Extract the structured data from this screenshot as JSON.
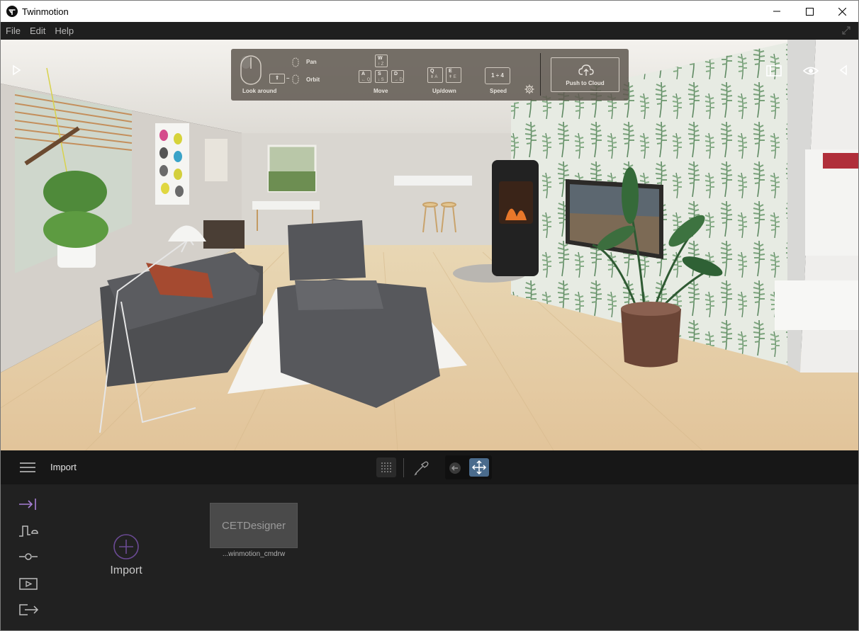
{
  "window": {
    "title": "Twinmotion",
    "logo_icon": "twinmotion-logo",
    "controls": [
      "minimize-icon",
      "maximize-icon",
      "close-icon"
    ]
  },
  "menu": {
    "items": [
      "File",
      "Edit",
      "Help"
    ],
    "right_icon": "fullscreen-expand-icon"
  },
  "viewport": {
    "left_icon": "play-icon",
    "right_icons": [
      "panel-toggle-icon",
      "eye-icon",
      "collapse-arrow-icon"
    ],
    "nav_help": {
      "look_label": "Look around",
      "pan_label": "Pan",
      "orbit_label": "Orbit",
      "move_label": "Move",
      "updown_label": "Up/down",
      "speed_label": "Speed",
      "keys": {
        "w": "W",
        "w_alt": "↑ Z",
        "a": "A",
        "a_alt": "← Q",
        "s": "S",
        "s_alt": "↓ S",
        "d": "D",
        "d_alt": "→ D",
        "q": "Q",
        "q_alt": "⇟ A",
        "e": "E",
        "e_alt": "⇞ E",
        "shift": "⇧"
      },
      "speed_value": "1 ÷ 4",
      "settings_icon": "gear-icon",
      "cloud_button": "Push to Cloud"
    }
  },
  "bottom": {
    "menu_icon": "hamburger-icon",
    "section_title": "Import",
    "tools": [
      "grid-snap-icon",
      "eyedropper-icon",
      "back-arrow-icon",
      "move-arrows-icon"
    ],
    "sidebar_icons": [
      "import-icon",
      "context-icon",
      "settings-slider-icon",
      "media-icon",
      "export-icon"
    ],
    "import_label": "Import",
    "asset": {
      "thumbnail_text": "CETDesigner",
      "name": "...winmotion_cmdrw"
    }
  },
  "colors": {
    "accent": "#a77fd6",
    "active_tool": "#4a6b8c",
    "overlay": "#605850"
  }
}
